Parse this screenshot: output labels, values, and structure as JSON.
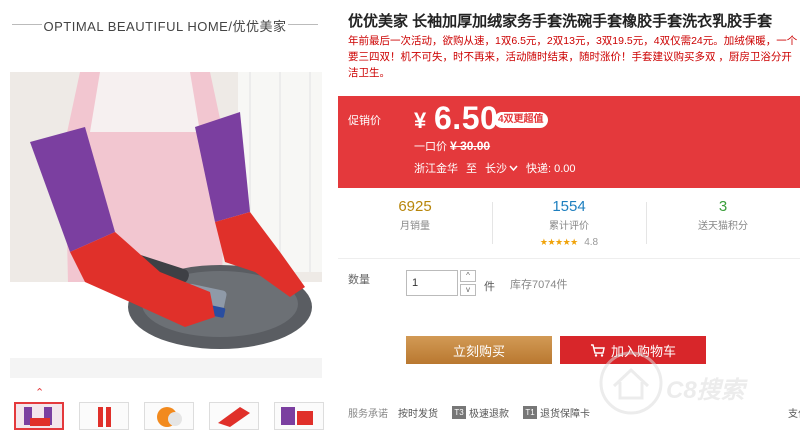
{
  "shop": {
    "title": "OPTIMAL BEAUTIFUL HOME/优优美家"
  },
  "gallery": {
    "up_arrow": "⌃",
    "thumbnails": [
      "thumb-1",
      "thumb-2",
      "thumb-3",
      "thumb-4",
      "thumb-5"
    ]
  },
  "product": {
    "title": "优优美家 长袖加厚加绒家务手套洗碗手套橡胶手套洗衣乳胶手套",
    "description": "年前最后一次活动，欲购从速，1双6.5元，2双13元，3双19.5元，4双仅需24元。加绒保暖，一个要三四双！机不可失，时不再来，活动随时结束，随时涨价！手套建议购买多双 ，厨房卫浴分开洁卫生。"
  },
  "price": {
    "label": "促销价",
    "currency": "¥",
    "value": "6.50",
    "badge": "4双更超值",
    "orig_label": "一口价",
    "orig_value": "¥ 30.00",
    "ship_from": "浙江金华",
    "ship_to_label": "至",
    "ship_dest": "长沙",
    "express": "快递: 0.00"
  },
  "stats": [
    {
      "num": "6925",
      "label": "月销量"
    },
    {
      "num": "1554",
      "label": "累计评价",
      "stars": "★★★★★",
      "rating": "4.8"
    },
    {
      "num": "3",
      "label": "送天猫积分"
    }
  ],
  "quantity": {
    "label": "数量",
    "value": "1",
    "unit": "件",
    "stock": "库存7074件",
    "up": "^",
    "down": "v"
  },
  "buttons": {
    "buy": "立刻购买",
    "cart": "加入购物车"
  },
  "promise": {
    "label": "服务承诺",
    "items": [
      {
        "icon": "",
        "text": "按时发货"
      },
      {
        "icon": "T3",
        "text": "极速退款"
      },
      {
        "icon": "T1",
        "text": "退货保障卡"
      }
    ],
    "tail": "支付"
  },
  "watermark": {
    "text": "C8搜索"
  },
  "colors": {
    "accent": "#e4393c",
    "buy": "#c4853d",
    "cart": "#d8262a",
    "stat_blue": "#1e7fbf",
    "stat_green": "#3a9e3a"
  }
}
